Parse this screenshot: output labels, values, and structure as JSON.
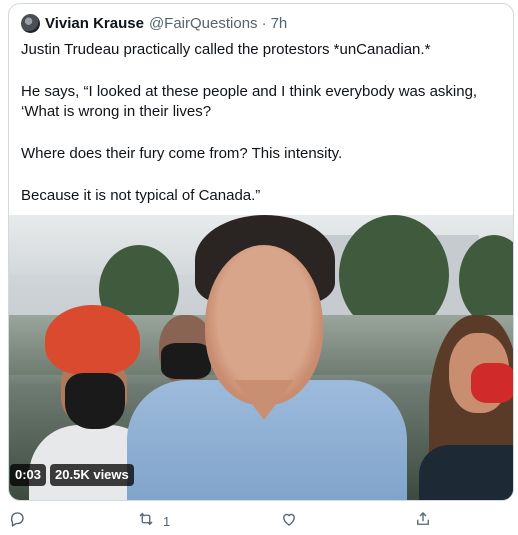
{
  "quote": {
    "author_name": "Vivian Krause",
    "author_handle": "@FairQuestions",
    "separator": "·",
    "time": "7h",
    "paragraphs": [
      "Justin Trudeau practically called the protestors *unCanadian.*",
      "He says, “I looked at these people and I think everybody was asking, ‘What is wrong in their lives?",
      "Where does their fury come from? This intensity.",
      "Because it is not typical of Canada.”"
    ]
  },
  "video": {
    "duration": "0:03",
    "views": "20.5K views"
  },
  "actions": {
    "reply_icon": "reply-icon",
    "retweet_icon": "retweet-icon",
    "retweet_count": "1",
    "like_icon": "like-icon",
    "share_icon": "share-icon"
  },
  "colors": {
    "text": "#0f1419",
    "secondary": "#536471",
    "border": "#cfd9de"
  }
}
